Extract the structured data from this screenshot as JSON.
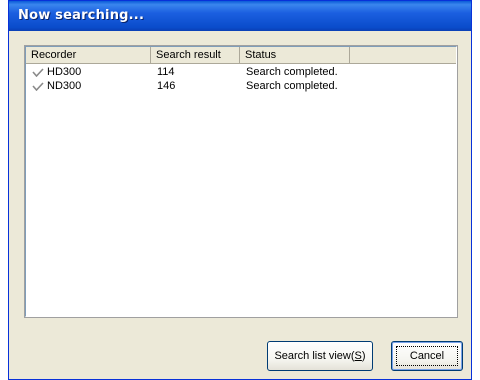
{
  "window": {
    "title": "Now searching..."
  },
  "list": {
    "columns": [
      "Recorder",
      "Search result",
      "Status",
      ""
    ],
    "rows": [
      {
        "icon": "check-icon",
        "recorder": "HD300",
        "result": "114",
        "status": "Search completed."
      },
      {
        "icon": "check-icon",
        "recorder": "ND300",
        "result": "146",
        "status": "Search completed."
      }
    ]
  },
  "buttons": {
    "search_list_view": "Search list view",
    "search_list_view_shortcut": "S",
    "cancel": "Cancel"
  }
}
